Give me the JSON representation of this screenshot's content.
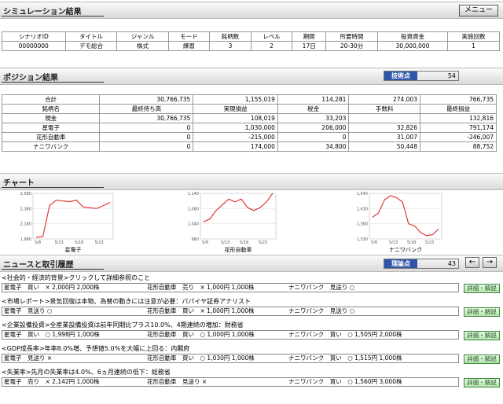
{
  "sim": {
    "title": "シミュレーション結果",
    "menu_label": "メニュー",
    "headers": [
      "シナリオID",
      "タイトル",
      "ジャンル",
      "モード",
      "銘柄数",
      "レベル",
      "期間",
      "所要時間",
      "投資資金",
      "実施回数"
    ],
    "row": [
      "00000000",
      "デモ総合",
      "株式",
      "練習",
      "3",
      "2",
      "17日",
      "20-30分",
      "30,000,000",
      "1"
    ]
  },
  "position": {
    "title": "ポジション結果",
    "score_label": "技術点",
    "score_value": "54",
    "total_label": "合計",
    "totals": [
      "30,766,735",
      "1,155,019",
      "114,281",
      "274,003",
      "766,735"
    ],
    "headers": [
      "銘柄名",
      "最終持ち高",
      "実現損益",
      "税金",
      "手数料",
      "最終損益"
    ],
    "rows": [
      [
        "現金",
        "30,766,735",
        "108,019",
        "33,203",
        "",
        "132,816"
      ],
      [
        "星電子",
        "0",
        "1,030,000",
        "206,000",
        "32,826",
        "791,174"
      ],
      [
        "花形自動車",
        "0",
        "-215,000",
        "0",
        "31,007",
        "-246,007"
      ],
      [
        "ナニワバンク",
        "0",
        "174,000",
        "34,800",
        "50,448",
        "88,752"
      ]
    ]
  },
  "chart": {
    "title": "チャート",
    "colors": {
      "line": "#e03a3a",
      "grid": "#dddddd"
    }
  },
  "chart_data": [
    {
      "type": "line",
      "title": "星電子",
      "x": [
        "5/8",
        "5/13",
        "5/18",
        "5/23"
      ],
      "ylim": [
        1980,
        2580
      ],
      "yticks": [
        "2,580",
        "2,380",
        "2,180",
        "1,980"
      ],
      "values": [
        2000,
        2010,
        2420,
        2490,
        2480,
        2470,
        2490,
        2400,
        2390,
        2380,
        2420,
        2460
      ]
    },
    {
      "type": "line",
      "title": "花形自動車",
      "x": [
        "5/8",
        "5/13",
        "5/18",
        "5/23"
      ],
      "ylim": [
        980,
        1140
      ],
      "yticks": [
        "1,140",
        "1,080",
        "1,040",
        "980"
      ],
      "values": [
        1040,
        1050,
        1080,
        1100,
        1120,
        1110,
        1120,
        1090,
        1080,
        1090,
        1110,
        1140
      ]
    },
    {
      "type": "line",
      "title": "ナニワバンク",
      "x": [
        "5/8",
        "5/13",
        "5/18",
        "5/23"
      ],
      "ylim": [
        1330,
        1540
      ],
      "yticks": [
        "1,540",
        "1,430",
        "1,380",
        "1,330"
      ],
      "values": [
        1430,
        1450,
        1510,
        1530,
        1520,
        1500,
        1400,
        1390,
        1360,
        1345,
        1350,
        1375
      ]
    }
  ],
  "news": {
    "title": "ニュースと取引履歴",
    "score_label": "理論点",
    "score_value": "43",
    "prev_icon": "arrow-left-icon",
    "next_icon": "arrow-right-icon",
    "detail_label": "詳細・解説",
    "items": [
      {
        "headline": "<社会的・経済的背景>クリックして詳細参照のこと",
        "t1": "星電子　買い　× 2,000円 2,000株",
        "t2": "花形自動車　売り　× 1,000円 1,000株",
        "t3": "ナニワバンク　見送り ○"
      },
      {
        "headline": "<市場レポート>景気回復は本物、為替の動きには注意が必要：パパイヤ証券アナリスト",
        "t1": "星電子　見送り ○",
        "t2": "花形自動車　買い　× 1,000円 1,000株",
        "t3": "ナニワバンク　見送り ○"
      },
      {
        "headline": "<企業設備投資>全産業設備投資は前年同期比プラス10.0%、4期連続の増加：財務省",
        "t1": "星電子　買い　○ 1,998円 1,000株",
        "t2": "花形自動車　買い　○ 1,000円 1,000株",
        "t3": "ナニワバンク　買い　○ 1,505円 2,000株"
      },
      {
        "headline": "<GDP成長率>年率8.0%増、予想値5.0%を大幅に上回る：内閣府",
        "t1": "星電子　見送り ×",
        "t2": "花形自動車　買い　○ 1,030円 1,000株",
        "t3": "ナニワバンク　買い　○ 1,515円 1,000株"
      },
      {
        "headline": "<失業率>先月の失業率は4.0%、6ヵ月連続の低下：総務省",
        "t1": "星電子　売り　× 2,142円 1,000株",
        "t2": "花形自動車　見送り ×",
        "t3": "ナニワバンク　買い　○ 1,560円 3,000株"
      }
    ]
  }
}
